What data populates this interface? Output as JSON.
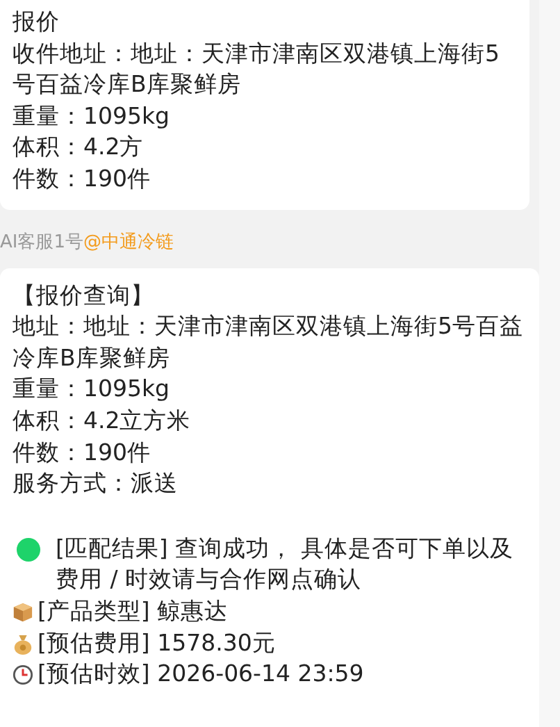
{
  "messages": [
    {
      "kind": "bubble",
      "lines": [
        "报价",
        "收件地址：地址：天津市津南区双港镇上海街5号百益冷库B库聚鲜房",
        "重量：1095kg",
        "体积：4.2方",
        "件数：190件"
      ]
    },
    {
      "kind": "sender",
      "name": "AI客服1号",
      "org": "@中通冷链"
    },
    {
      "kind": "bubble",
      "lines": [
        "【报价查询】",
        "地址：地址：天津市津南区双港镇上海街5号百益冷库B库聚鲜房",
        "重量：1095kg",
        "体积：4.2立方米",
        "件数：190件",
        "服务方式：派送"
      ],
      "results": [
        {
          "kind": "dot",
          "text": "[匹配结果] 查询成功， 具体是否可下单以及费用 / 时效请与合作网点确认"
        },
        {
          "kind": "box",
          "text": "[产品类型] 鲸惠达"
        },
        {
          "kind": "moneybag",
          "text": "[预估费用]  1578.30元"
        },
        {
          "kind": "clock",
          "text": "[预估时效] 2026-06-14 23:59"
        }
      ]
    }
  ]
}
